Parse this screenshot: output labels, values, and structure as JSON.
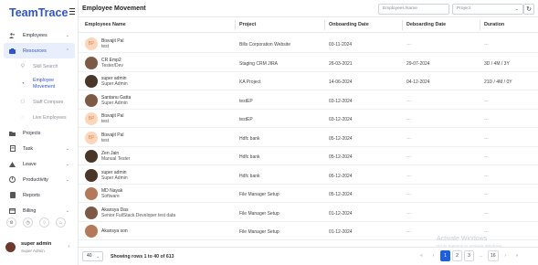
{
  "app": {
    "brand": "TeamTrace"
  },
  "header": {
    "title": "Employee Movement",
    "search_placeholder": "Employees Name",
    "project_select": "Project"
  },
  "sidebar": {
    "items": [
      {
        "label": "Employees",
        "icon": "users-icon",
        "has_chevron": true
      },
      {
        "label": "Resources",
        "icon": "resources-icon",
        "has_chevron": true,
        "active": true
      },
      {
        "label": "Projects",
        "icon": "projects-icon",
        "has_chevron": false
      },
      {
        "label": "Task",
        "icon": "task-icon",
        "has_chevron": true
      },
      {
        "label": "Leave",
        "icon": "leave-icon",
        "has_chevron": true
      },
      {
        "label": "Productivity",
        "icon": "productivity-icon",
        "has_chevron": true
      },
      {
        "label": "Reports",
        "icon": "reports-icon",
        "has_chevron": false
      },
      {
        "label": "Billing",
        "icon": "billing-icon",
        "has_chevron": true
      }
    ],
    "sub_items": [
      {
        "label": "Skill Search",
        "icon": "skill-search-icon"
      },
      {
        "label": "Employee Movement",
        "icon": "movement-icon",
        "active": true
      },
      {
        "label": "Staff Compare",
        "icon": "staff-compare-icon"
      },
      {
        "label": "Live Employees",
        "icon": "live-employees-icon"
      }
    ],
    "user": {
      "name": "super admin",
      "role": "Super Admin"
    }
  },
  "table": {
    "columns": [
      "Employees Name",
      "Project",
      "Onboarding Date",
      "Deboarding Date",
      "Duration"
    ],
    "rows": [
      {
        "initials": "BP",
        "avatar": "initials",
        "name": "Bisvajit Pal",
        "role": "test",
        "project": "Bills Corporation Website",
        "onboarding": "03-11-2024",
        "deboarding": "---",
        "duration": "---"
      },
      {
        "initials": "",
        "avatar": "photo",
        "name": "CR Emp2",
        "role": "Tester/Dev",
        "project": "Staging CRM JIRA",
        "onboarding": "26-03-2021",
        "deboarding": "29-07-2024",
        "duration": "3D / 4M / 3Y"
      },
      {
        "initials": "",
        "avatar": "photo2",
        "name": "super admin",
        "role": "Super Admin",
        "project": "KA Project",
        "onboarding": "14-06-2024",
        "deboarding": "04-12-2024",
        "duration": "21D / 4M / 0Y"
      },
      {
        "initials": "",
        "avatar": "photo",
        "name": "Santanu Gatta",
        "role": "Super Admin",
        "project": "testEP",
        "onboarding": "03-12-2024",
        "deboarding": "---",
        "duration": "---"
      },
      {
        "initials": "BP",
        "avatar": "initials",
        "name": "Bisvajit Pal",
        "role": "test",
        "project": "testEP",
        "onboarding": "03-12-2024",
        "deboarding": "---",
        "duration": "---"
      },
      {
        "initials": "BP",
        "avatar": "initials",
        "name": "Bisvajit Pal",
        "role": "test",
        "project": "Hdfc bank",
        "onboarding": "05-12-2024",
        "deboarding": "---",
        "duration": "---"
      },
      {
        "initials": "",
        "avatar": "photo2",
        "name": "Zen Jain",
        "role": "Manual Tester",
        "project": "Hdfc bank",
        "onboarding": "05-12-2024",
        "deboarding": "---",
        "duration": "---"
      },
      {
        "initials": "",
        "avatar": "photo2",
        "name": "super admin",
        "role": "Super Admin",
        "project": "Hdfc bank",
        "onboarding": "05-12-2024",
        "deboarding": "---",
        "duration": "---"
      },
      {
        "initials": "",
        "avatar": "photo3",
        "name": "MD Nayak",
        "role": "Software",
        "project": "File Manager Setup",
        "onboarding": "05-12-2024",
        "deboarding": "---",
        "duration": "---"
      },
      {
        "initials": "",
        "avatar": "photo",
        "name": "Akansya Das",
        "role": "Senior FullStack Developer test data",
        "project": "File Manager Setup",
        "onboarding": "01-12-2024",
        "deboarding": "---",
        "duration": "---"
      },
      {
        "initials": "",
        "avatar": "photo3",
        "name": "Akansya son",
        "role": "",
        "project": "File Manager Setup",
        "onboarding": "01-12-2024",
        "deboarding": "---",
        "duration": "---"
      }
    ]
  },
  "footer": {
    "per_page": "40",
    "rows_text": "Showing rows 1 to 40 of 613",
    "pages": [
      "1",
      "2",
      "3",
      "...",
      "16"
    ]
  },
  "watermark": {
    "line1": "Activate Windows",
    "line2": "Go to Settings to activate Windows."
  },
  "colors": {
    "brand": "#2f54c6",
    "active_page": "#1f5fd8",
    "sidebar_active_bg": "#e8eefc"
  }
}
